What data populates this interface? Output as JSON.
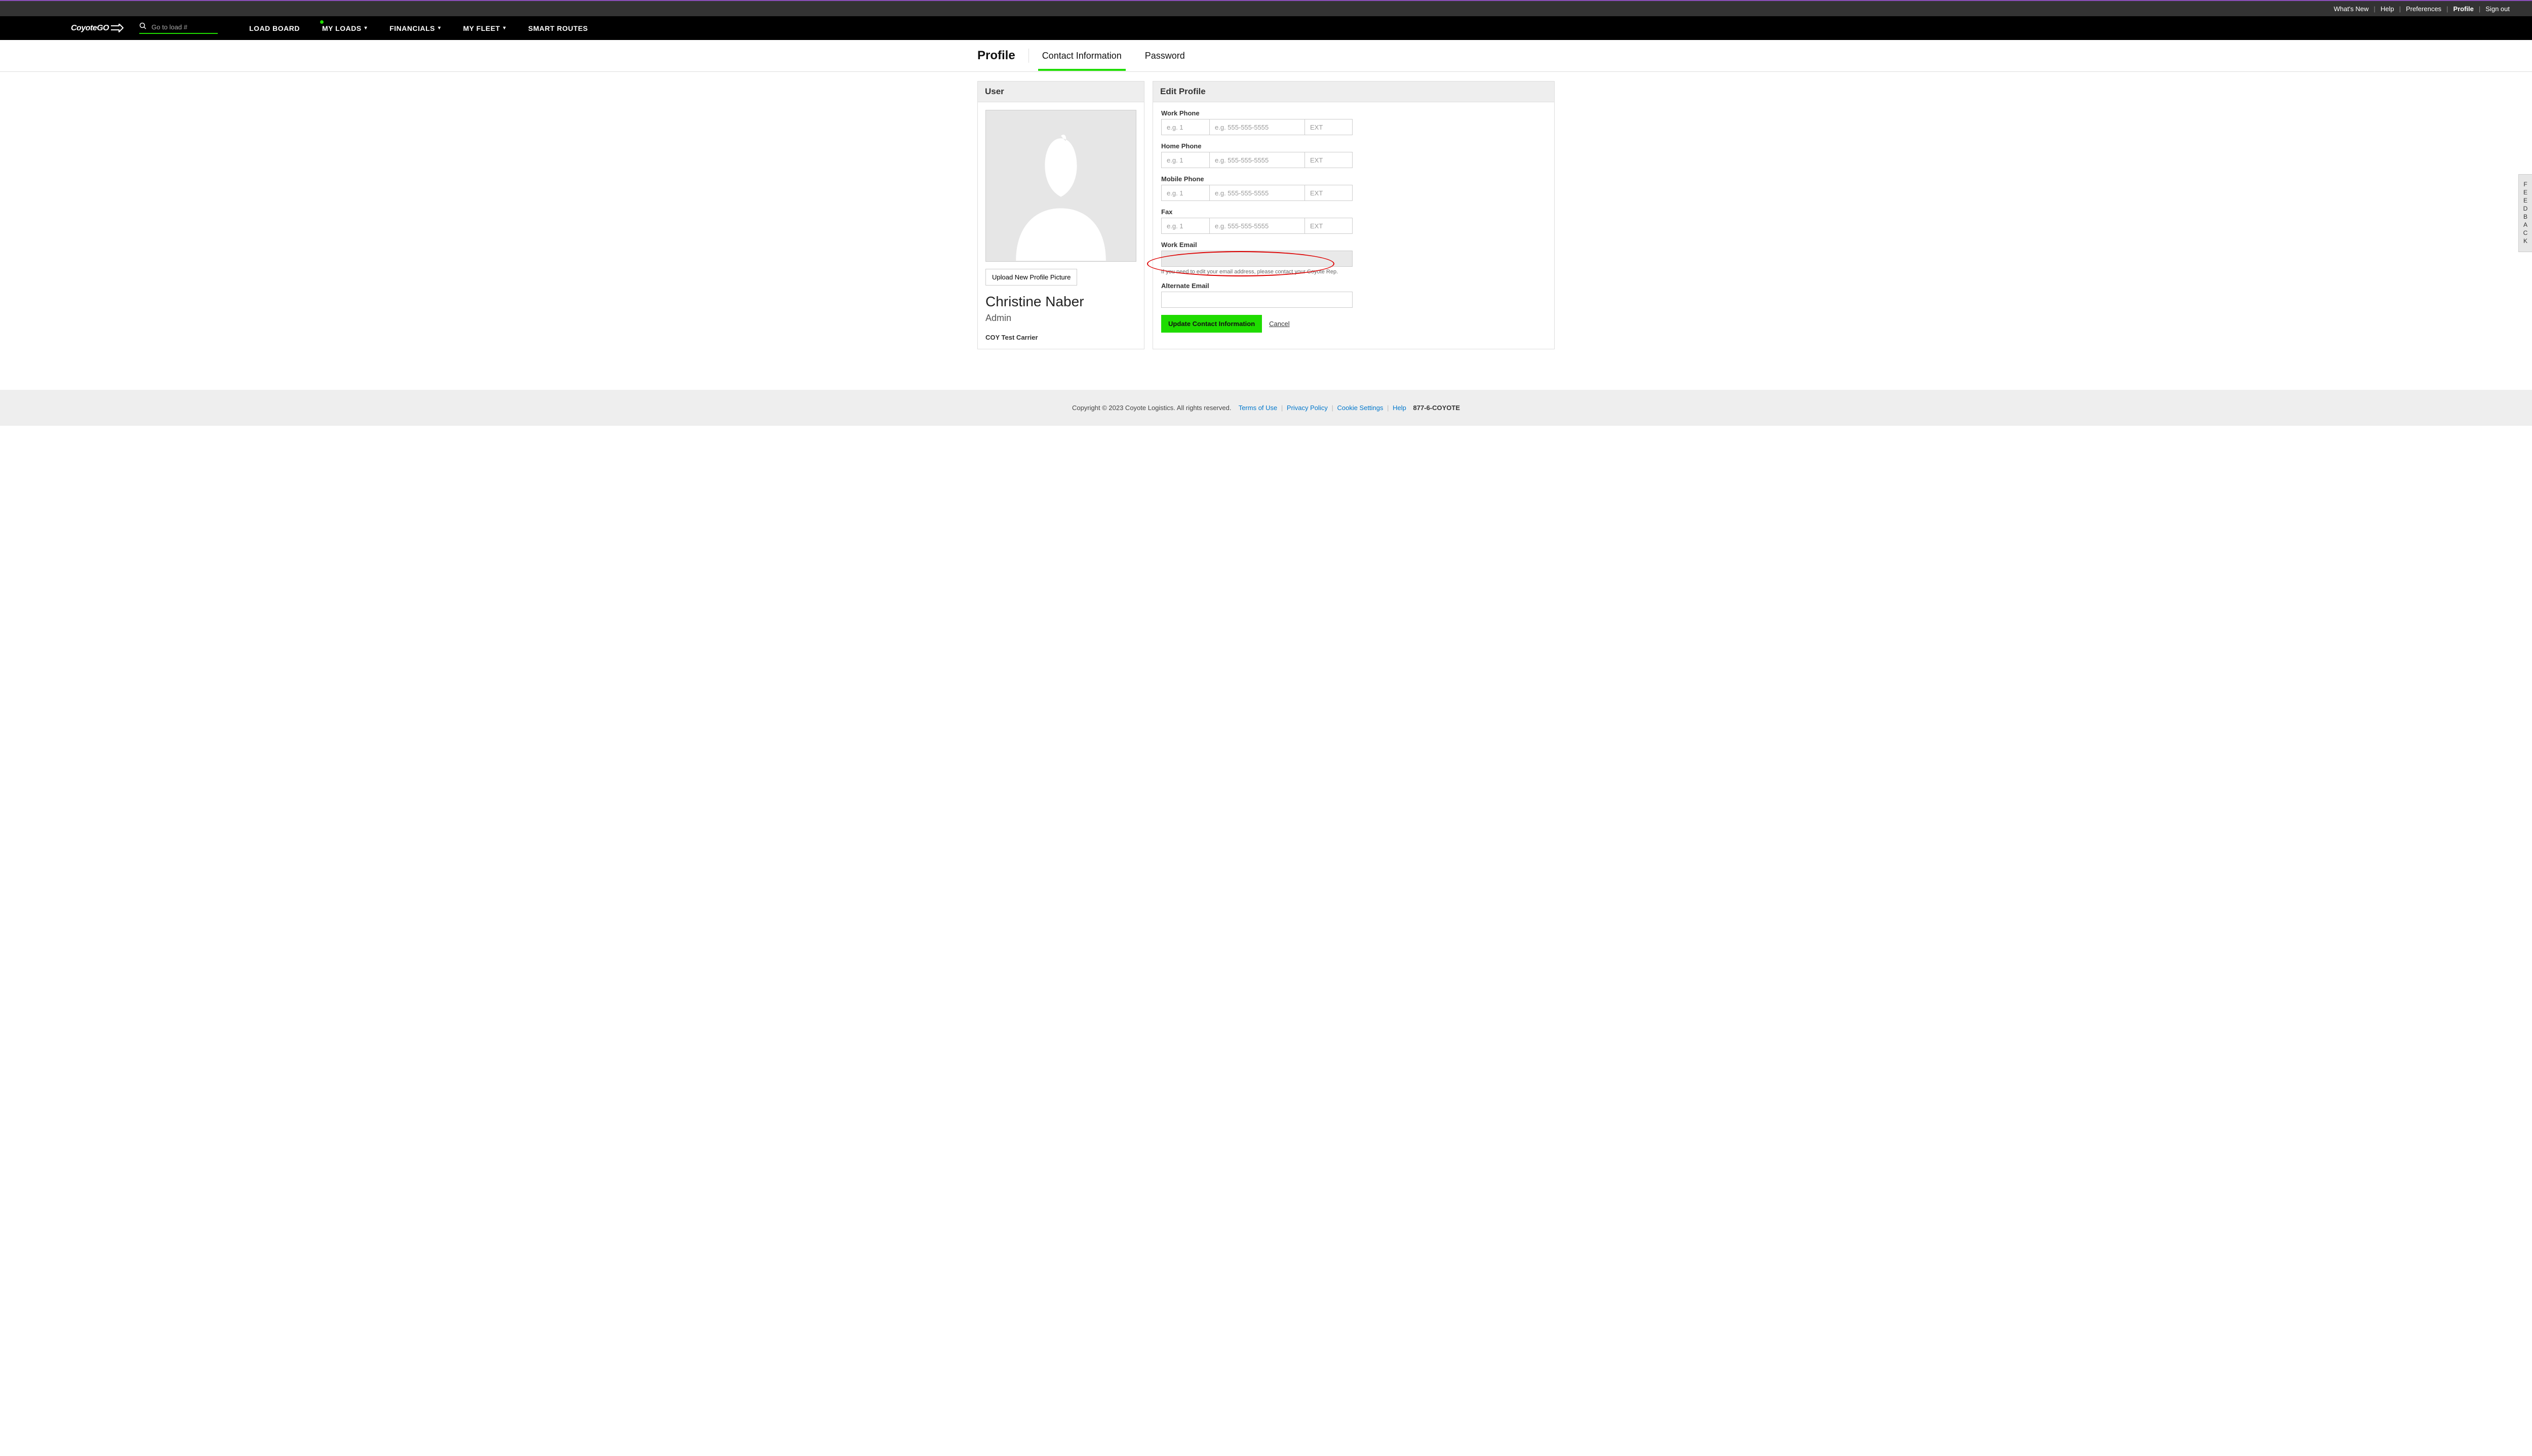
{
  "utilbar": {
    "whats_new": "What's New",
    "help": "Help",
    "preferences": "Preferences",
    "profile": "Profile",
    "sign_out": "Sign out"
  },
  "logo": "CoyoteGO",
  "search": {
    "placeholder": "Go to load #"
  },
  "nav": {
    "load_board": "LOAD BOARD",
    "my_loads": "MY LOADS",
    "financials": "FINANCIALS",
    "my_fleet": "MY FLEET",
    "smart_routes": "SMART ROUTES"
  },
  "subnav": {
    "title": "Profile",
    "contact_info": "Contact Information",
    "password": "Password"
  },
  "user_panel": {
    "header": "User",
    "upload_btn": "Upload New Profile Picture",
    "name": "Christine Naber",
    "role": "Admin",
    "company": "COY Test Carrier"
  },
  "edit_panel": {
    "header": "Edit Profile",
    "work_phone_label": "Work Phone",
    "home_phone_label": "Home Phone",
    "mobile_phone_label": "Mobile Phone",
    "fax_label": "Fax",
    "cc_placeholder": "e.g. 1",
    "num_placeholder": "e.g. 555-555-5555",
    "ext_placeholder": "EXT",
    "work_email_label": "Work Email",
    "work_email_hint": "If you need to edit your email address, please contact your Coyote Rep.",
    "alt_email_label": "Alternate Email",
    "submit": "Update Contact Information",
    "cancel": "Cancel"
  },
  "feedback": "FEEDBACK",
  "footer": {
    "copyright": "Copyright © 2023 Coyote Logistics. All rights reserved.",
    "terms": "Terms of Use",
    "privacy": "Privacy Policy",
    "cookie": "Cookie Settings",
    "help": "Help",
    "phone": "877-6-COYOTE"
  }
}
